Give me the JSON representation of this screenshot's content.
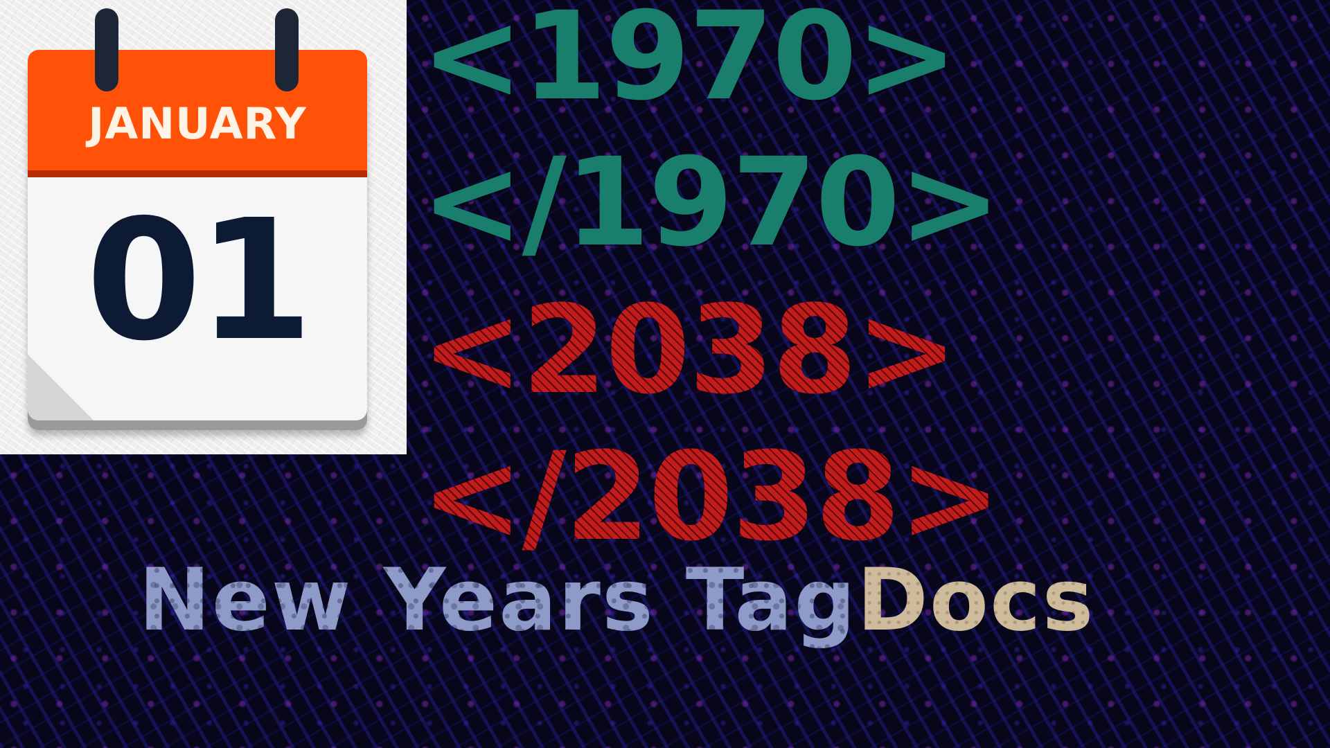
{
  "calendar": {
    "month": "JANUARY",
    "day": "01",
    "header_color": "#ff5108",
    "ring_icon": "calendar-icon"
  },
  "tags": [
    {
      "text": "<1970>",
      "color": "#1a7e6c"
    },
    {
      "text": "</1970>",
      "color": "#1a7e6c"
    },
    {
      "text": "<2038>",
      "color": "#b31616"
    },
    {
      "text": "</2038>",
      "color": "#b31616"
    }
  ],
  "title": {
    "main": "New Years Tag",
    "accent": "Docs"
  },
  "colors": {
    "background": "#07061a",
    "title_main": "#8e9bc8",
    "title_accent": "#cdbb9b"
  }
}
